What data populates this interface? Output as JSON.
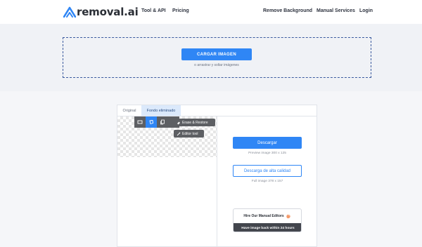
{
  "header": {
    "logo_text": "removal.ai",
    "nav": {
      "tool_api": "Tool & API",
      "pricing": "Pricing",
      "remove_background": "Remove Background",
      "manual_services": "Manual Services",
      "login": "Login"
    }
  },
  "upload": {
    "button_label": "CARGAR IMAGEN",
    "hint": "o arrastrar y soltar imágenes"
  },
  "result": {
    "tabs": [
      "Original",
      "Fondo eliminado"
    ],
    "active_tab": "Fondo eliminado",
    "tools": [
      "crop-icon",
      "lasso-icon",
      "copy-icon"
    ],
    "erase_restore_label": "Erase & Restore",
    "editor_label": "Editor tool",
    "download_label": "Descargar",
    "preview_size": "Preview image  300 x 125",
    "hq_label": "Descarga de alta calidad",
    "full_size": "Full image  378 x 157",
    "hire_title": "Hire Our Manual Editors",
    "hire_sub": "Have image back within 24 hours"
  },
  "colors": {
    "accent": "#2f86f5",
    "dark_tool": "#5d5f63",
    "band": "#f0f2f6",
    "dropzone_border": "#3a5a9e"
  }
}
